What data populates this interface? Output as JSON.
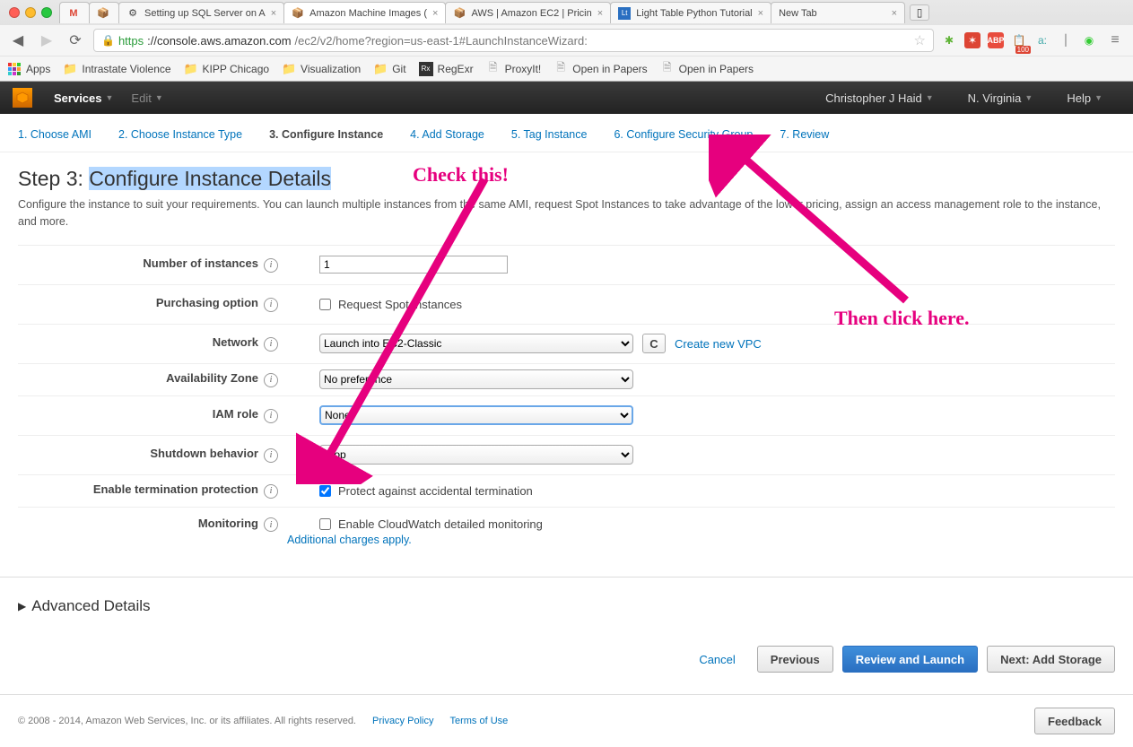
{
  "browser": {
    "tabs": [
      {
        "label": "",
        "favicon": "M"
      },
      {
        "label": "",
        "favicon": "📦"
      },
      {
        "label": "Setting up SQL Server on A",
        "favicon": "⚙"
      },
      {
        "label": "Amazon Machine Images (",
        "favicon": "📦"
      },
      {
        "label": "AWS | Amazon EC2 | Pricin",
        "favicon": "📦"
      },
      {
        "label": "Light Table Python Tutorial",
        "favicon": "Lt"
      },
      {
        "label": "New Tab",
        "favicon": ""
      }
    ],
    "url_https": "https",
    "url_host": "://console.aws.amazon.com",
    "url_path": "/ec2/v2/home?region=us-east-1#LaunchInstanceWizard:"
  },
  "bookmarks": {
    "apps": "Apps",
    "items": [
      "Intrastate Violence",
      "KIPP Chicago",
      "Visualization",
      "Git",
      "RegExr",
      "ProxyIt!",
      "Open in Papers",
      "Open in Papers"
    ]
  },
  "aws_nav": {
    "services": "Services",
    "edit": "Edit",
    "user": "Christopher J Haid",
    "region": "N. Virginia",
    "help": "Help"
  },
  "wizard_tabs": [
    "1. Choose AMI",
    "2. Choose Instance Type",
    "3. Configure Instance",
    "4. Add Storage",
    "5. Tag Instance",
    "6. Configure Security Group",
    "7. Review"
  ],
  "step": {
    "prefix": "Step 3: ",
    "highlight": "Configure Instance Details",
    "desc": "Configure the instance to suit your requirements. You can launch multiple instances from the same AMI, request Spot Instances to take advantage of the lower pricing, assign an access management role to the instance, and more."
  },
  "form": {
    "num_label": "Number of instances",
    "num_val": "1",
    "purch_label": "Purchasing option",
    "purch_cb": "Request Spot Instances",
    "net_label": "Network",
    "net_val": "Launch into EC2-Classic",
    "net_link": "Create new VPC",
    "az_label": "Availability Zone",
    "az_val": "No preference",
    "iam_label": "IAM role",
    "iam_val": "None",
    "shut_label": "Shutdown behavior",
    "shut_val": "Stop",
    "term_label": "Enable termination protection",
    "term_cb": "Protect against accidental termination",
    "mon_label": "Monitoring",
    "mon_cb": "Enable CloudWatch detailed monitoring",
    "mon_link": "Additional charges apply."
  },
  "advanced": "Advanced Details",
  "buttons": {
    "cancel": "Cancel",
    "prev": "Previous",
    "review": "Review and Launch",
    "next": "Next: Add Storage"
  },
  "footer": {
    "copy": "© 2008 - 2014, Amazon Web Services, Inc. or its affiliates. All rights reserved.",
    "privacy": "Privacy Policy",
    "terms": "Terms of Use",
    "feedback": "Feedback"
  },
  "annot": {
    "check": "Check this!",
    "then": "Then click here."
  }
}
